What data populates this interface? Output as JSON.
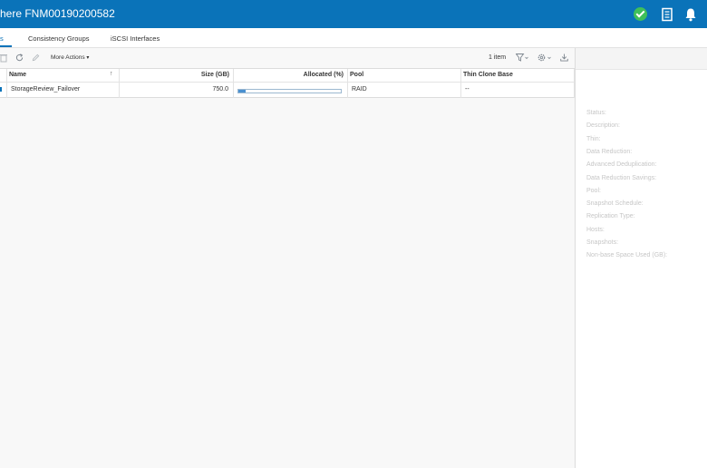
{
  "header": {
    "title": "here FNM00190200582",
    "icons": [
      "check-circle-icon",
      "document-icon",
      "bell-icon"
    ],
    "colors": {
      "bar": "#0a73b9",
      "ok": "#3fbf5a"
    }
  },
  "tabs": [
    {
      "label": "s",
      "active": true
    },
    {
      "label": "Consistency Groups"
    },
    {
      "label": "iSCSI Interfaces"
    }
  ],
  "toolbar": {
    "more_actions": "More Actions",
    "item_count": "1 item",
    "icons": [
      "delete-icon",
      "refresh-icon",
      "edit-icon",
      "filter-icon",
      "settings-icon",
      "download-icon"
    ]
  },
  "table": {
    "columns": [
      "Name",
      "Size (GB)",
      "Allocated (%)",
      "Pool",
      "Thin Clone Base"
    ],
    "rows": [
      {
        "name": "StorageReview_Failover",
        "size": "750.0",
        "allocated_fraction": 0.07,
        "pool": "RAID",
        "thin_clone_base": "--"
      }
    ]
  },
  "details": {
    "labels": [
      "Status:",
      "Description:",
      "Thin:",
      "Data Reduction:",
      "Advanced Deduplication:",
      "Data Reduction Savings:",
      "Pool:",
      "Snapshot Schedule:",
      "Replication Type:",
      "Hosts:",
      "Snapshots:",
      "Non-base Space Used (GB):"
    ]
  }
}
